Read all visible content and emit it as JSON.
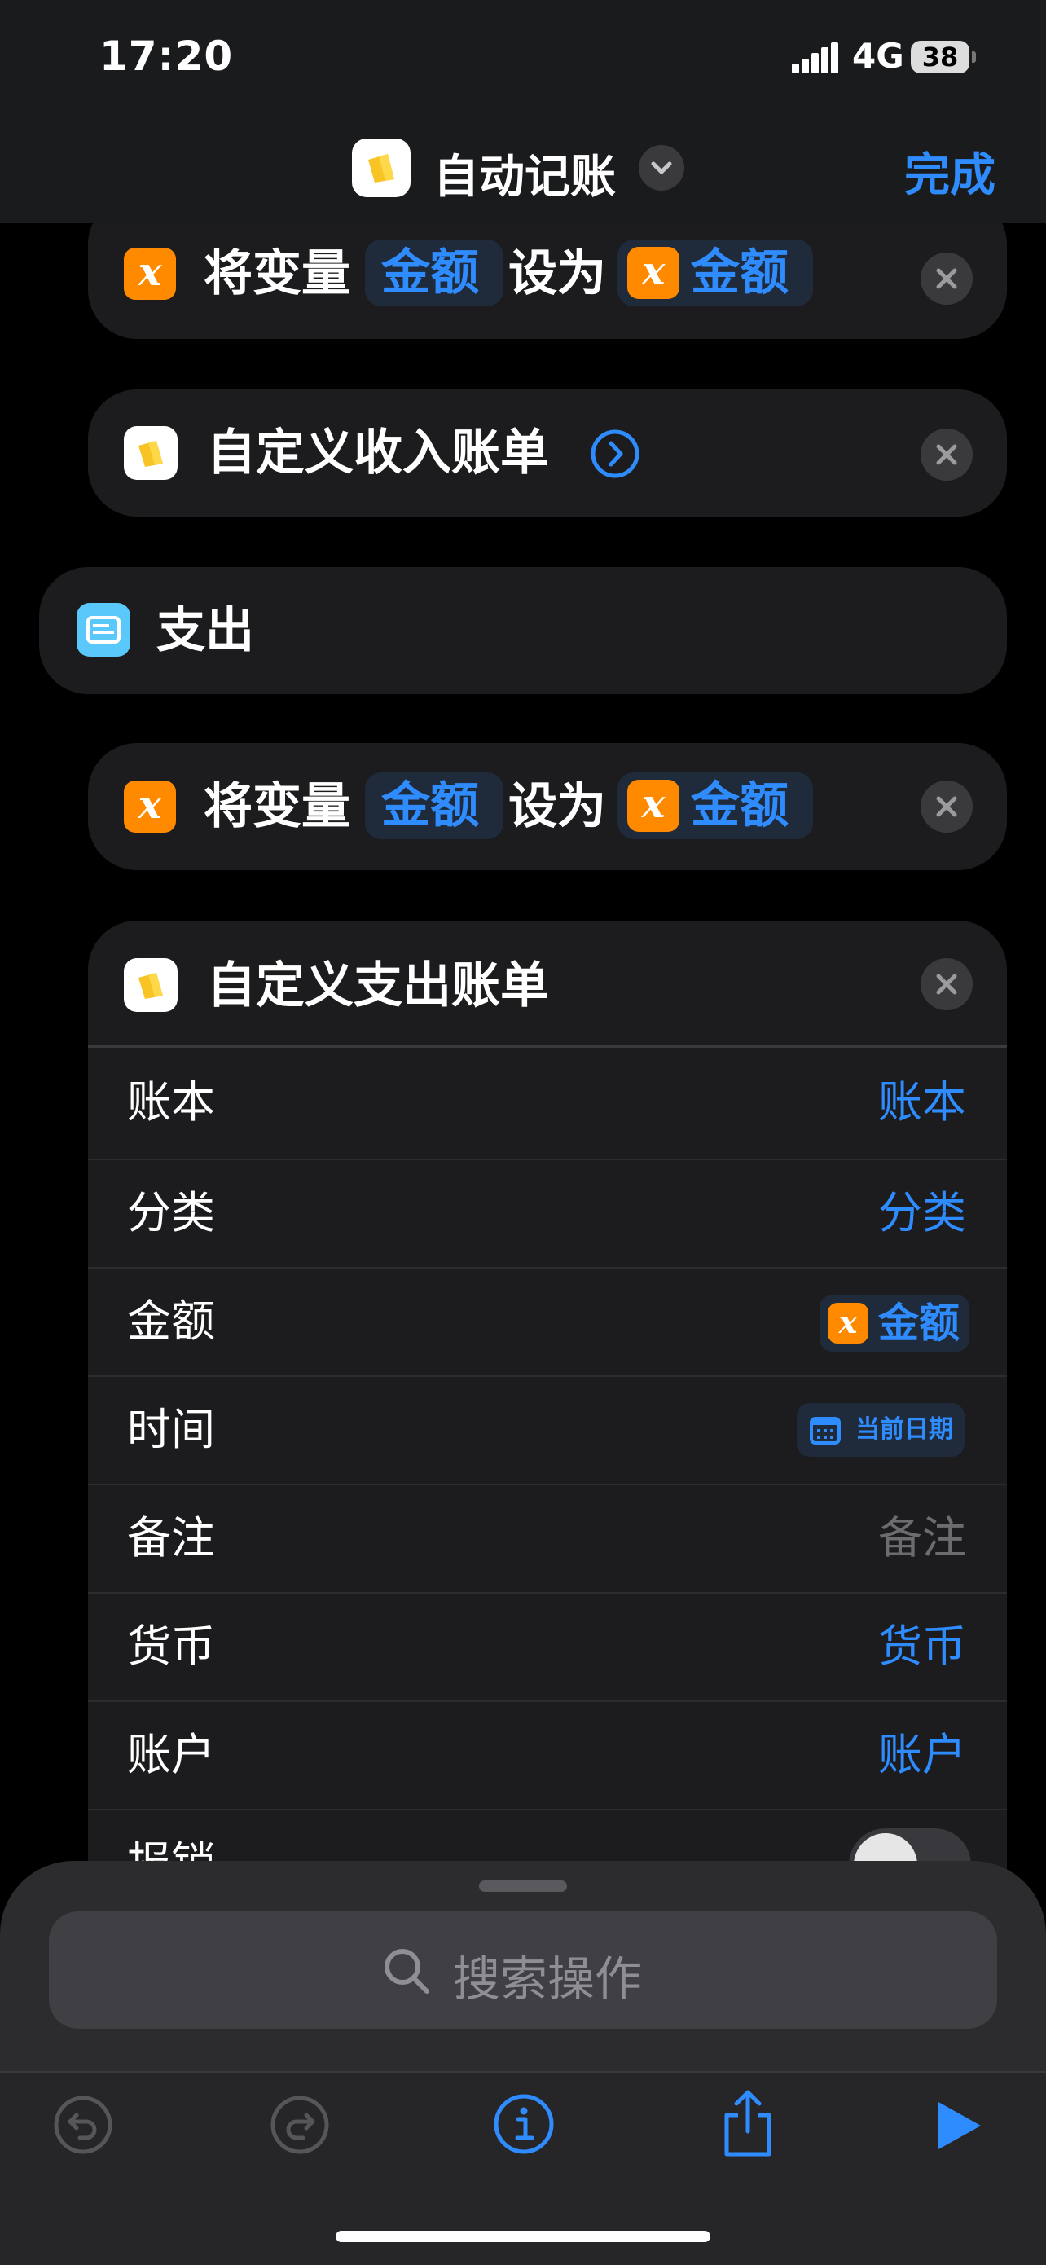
{
  "status": {
    "time": "17:20",
    "network": "4G",
    "battery": "38"
  },
  "nav": {
    "title": "自动记账",
    "done": "完成"
  },
  "actions": {
    "set_var_1": {
      "prefix": "将变量",
      "var_name": "金额",
      "mid": "设为",
      "value": "金额"
    },
    "income": {
      "label": "自定义收入账单"
    },
    "branch": {
      "label": "支出"
    },
    "set_var_2": {
      "prefix": "将变量",
      "var_name": "金额",
      "mid": "设为",
      "value": "金额"
    },
    "expense": {
      "label": "自定义支出账单",
      "rows": [
        {
          "key": "账本",
          "value": "账本"
        },
        {
          "key": "分类",
          "value": "分类"
        },
        {
          "key": "金额",
          "value": "金额"
        },
        {
          "key": "时间",
          "value": "当前日期"
        },
        {
          "key": "备注",
          "value": "备注"
        },
        {
          "key": "货币",
          "value": "货币"
        },
        {
          "key": "账户",
          "value": "账户"
        },
        {
          "key": "报销",
          "value": ""
        }
      ]
    }
  },
  "search": {
    "placeholder": "搜索操作"
  },
  "colors": {
    "accent": "#2F8CFF",
    "variable": "#FF8A00",
    "background": "#000000",
    "card": "#1C1C1E"
  }
}
